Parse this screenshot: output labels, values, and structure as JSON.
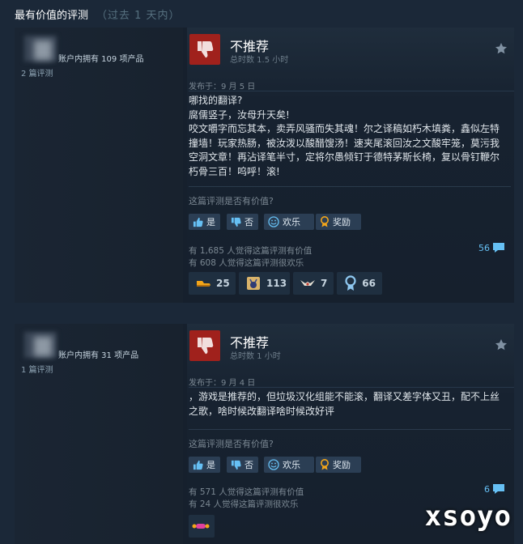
{
  "section": {
    "title": "最有价值的评测",
    "subtitle": "（过去 1 天内）"
  },
  "reviews": [
    {
      "owns": "账户内拥有 109 项产品",
      "review_count": "2 篇评测",
      "verdict": "不推荐",
      "hours": "总时数 1.5 小时",
      "posted": "发布于：9 月 5 日",
      "body": [
        "哪找的翻译?",
        "腐儒竖子，汝母升天矣!",
        "咬文嚼字而忘其本，卖弄风骚而失其魂！尔之译稿如朽木填粪，鑫似左特撞墙！玩家热肠，被汝泼以酸醋馊汤！速夹尾滚回汝之文酸牢笼，莫污我空洞文章！再沾译笔半寸，定将尔愚倾钉于德特茅斯长椅，复以骨钉鞭尔朽骨三百！呜呼！滚!"
      ],
      "helpful_question": "这篇评测是否有价值?",
      "buttons": [
        "是",
        "否",
        "欢乐",
        "奖励"
      ],
      "helpful_stat": "有 1,685 人觉得这篇评测有价值",
      "funny_stat": "有 608 人觉得这篇评测很欢乐",
      "comments": "56",
      "awards": [
        {
          "icon": "boot-award-icon",
          "count": "25"
        },
        {
          "icon": "hollow-knight-award-icon",
          "count": "113"
        },
        {
          "icon": "bird-award-icon",
          "count": "7"
        },
        {
          "icon": "medal-award-icon",
          "count": "66"
        }
      ]
    },
    {
      "owns": "账户内拥有 31 项产品",
      "review_count": "1 篇评测",
      "verdict": "不推荐",
      "hours": "总时数 1 小时",
      "posted": "发布于：9 月 4 日",
      "body": [
        "，游戏是推荐的，但垃圾汉化组能不能滚，翻译又差字体又丑，配不上丝之歌，啥时候改翻译啥时候改好评"
      ],
      "helpful_question": "这篇评测是否有价值?",
      "buttons": [
        "是",
        "否",
        "欢乐",
        "奖励"
      ],
      "helpful_stat": "有 571 人觉得这篇评测有价值",
      "funny_stat": "有 24 人觉得这篇评测很欢乐",
      "comments": "6",
      "awards": [
        {
          "icon": "toy-award-icon",
          "count": ""
        }
      ]
    }
  ],
  "watermark": "xsoyo",
  "colors": {
    "page_bg": "#1b2838",
    "not_recommended": "#a0211c",
    "link_blue": "#66c0f4",
    "button_bg": "#2b3e54"
  }
}
